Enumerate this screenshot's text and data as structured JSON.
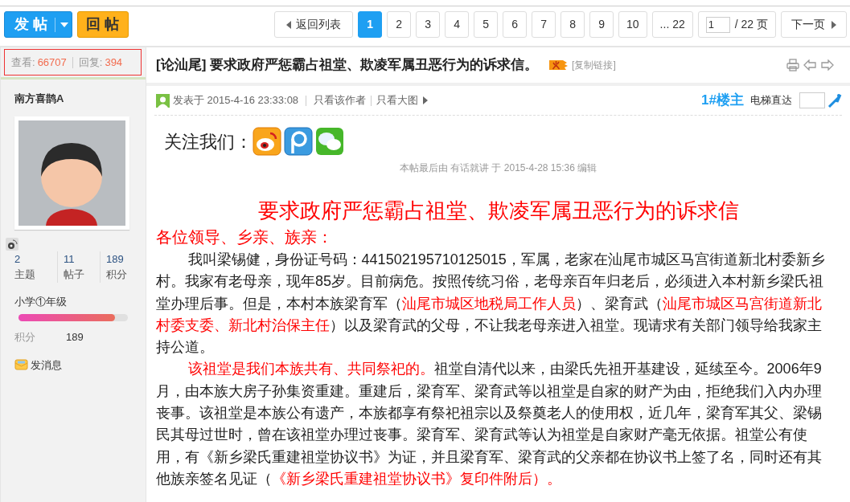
{
  "toolbar": {
    "post_button": "发 帖",
    "reply_button": "回 帖"
  },
  "pagination": {
    "back": "返回列表",
    "pages": [
      {
        "label": "1",
        "selected": true
      },
      {
        "label": "2",
        "selected": false
      },
      {
        "label": "3",
        "selected": false
      },
      {
        "label": "4",
        "selected": false
      },
      {
        "label": "5",
        "selected": false
      },
      {
        "label": "6",
        "selected": false
      },
      {
        "label": "7",
        "selected": false
      },
      {
        "label": "8",
        "selected": false
      },
      {
        "label": "9",
        "selected": false
      },
      {
        "label": "10",
        "selected": false
      },
      {
        "label": "... 22",
        "selected": false
      }
    ],
    "page_input": "1",
    "total": "/ 22 页",
    "next": "下一页"
  },
  "thread": {
    "views_label": "查看:",
    "views": "66707",
    "replies_label": "回复:",
    "replies": "394",
    "title": "[论汕尾] 要求政府严惩霸占祖堂、欺凌军属丑恶行为的诉求信。",
    "copy_link": "[复制链接]"
  },
  "author": {
    "name": "南方喜鹊A",
    "stats": [
      {
        "value": "2",
        "label": "主题"
      },
      {
        "value": "11",
        "label": "帖子"
      },
      {
        "value": "189",
        "label": "积分"
      }
    ],
    "rank": "小学①年级",
    "rank_bar": {
      "level": 0.88
    },
    "points_label": "积分",
    "points": "189",
    "message": "发消息"
  },
  "post": {
    "posted": "发表于 2015-4-16 23:33:08",
    "only_author": "只看该作者",
    "only_images": "只看大图",
    "floor": "1#楼主",
    "jump_label": "电梯直达",
    "follow": "关注我们：",
    "edited": "本帖最后由 有话就讲 于 2015-4-28 15:36 编辑",
    "heading": "要求政府严惩霸占祖堂、欺凌军属丑恶行为的诉求信",
    "greeting": "各位领导、乡亲、族亲：",
    "paragraphs": [
      {
        "segments": [
          {
            "text": "我叫梁锡健，身份证号码：441502195710125015，军属，老家在汕尾市城区马宫街道新北村委新乡村。我家有老母亲，现年85岁。目前病危。按照传统习俗，老母亲百年归老后，必须进入本村新乡梁氏祖堂办理后事。但是，本村本族梁育军（",
            "highlight": false
          },
          {
            "text": "汕尾市城区地税局工作人员",
            "highlight": true
          },
          {
            "text": "）、梁育武（",
            "highlight": false
          },
          {
            "text": "汕尾市城区马宫街道新北村委支委、新北村治保主任",
            "highlight": true
          },
          {
            "text": "）以及梁育武的父母，不让我老母亲进入祖堂。现请求有关部门领导给我家主持公道。",
            "highlight": false
          }
        ]
      },
      {
        "segments": [
          {
            "text": "该祖堂是我们本族共有、共同祭祀的。",
            "highlight": true
          },
          {
            "text": "祖堂自清代以来，由梁氏先祖开基建设，延续至今。2006年9月，由本族大房子孙集资重建。重建后，梁育军、梁育武等以祖堂是自家的财产为由，拒绝我们入内办理丧事。该祖堂是本族公有遗产，本族都享有祭祀祖宗以及祭奠老人的使用权，近几年，梁育军其父、梁锡民其母过世时，曾在该祖堂办理过丧事。梁育军、梁育武等认为祖堂是自家财产毫无依据。祖堂公有使用，有《新乡梁氏重建祖堂协议书》为证，并且梁育军、梁育武的父亲都在协议书上签了名，同时还有其他族亲签名见证（",
            "highlight": false
          },
          {
            "text": "《新乡梁氏重建祖堂协议书》复印件附后）。",
            "highlight": true
          }
        ]
      }
    ]
  }
}
